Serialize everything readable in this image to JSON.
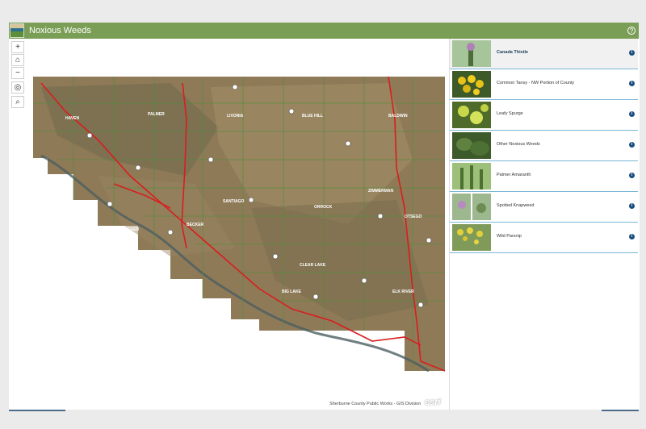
{
  "header": {
    "title": "Noxious Weeds",
    "help_icon": "help-icon"
  },
  "map": {
    "town_labels": [
      "HAVEN",
      "PALMER",
      "LIVONIA",
      "BLUE HILL",
      "BALDWIN",
      "BECKER",
      "ORROCK",
      "SANTIAGO",
      "ZIMMERMAN",
      "BIG LAKE",
      "ELK RIVER",
      "CLEAR LAKE",
      "BECKER",
      "OTSEGO"
    ],
    "attribution": "Sherburne County Public Works - GIS Division",
    "esri_logo": "esri"
  },
  "tools": [
    {
      "name": "zoom-in-button",
      "glyph": "+"
    },
    {
      "name": "home-button",
      "glyph": "⌂"
    },
    {
      "name": "zoom-out-button",
      "glyph": "−"
    },
    {
      "name": "locate-button",
      "glyph": "◎"
    },
    {
      "name": "search-button",
      "glyph": "⌕"
    }
  ],
  "weeds": [
    {
      "label": "Canada Thistle",
      "active": true
    },
    {
      "label": "Common Tansy - NW Portion of County",
      "active": false
    },
    {
      "label": "Leafy Spurge",
      "active": false
    },
    {
      "label": "Other Noxious Weeds",
      "active": false
    },
    {
      "label": "Palmer Amaranth",
      "active": false
    },
    {
      "label": "Spotted Knapweed",
      "active": false
    },
    {
      "label": "Wild Parsnip",
      "active": false
    }
  ],
  "colors": {
    "header": "#7b9e56",
    "divider": "#7bb6d8",
    "info": "#1a4e80",
    "roads": "#d81e1e"
  }
}
